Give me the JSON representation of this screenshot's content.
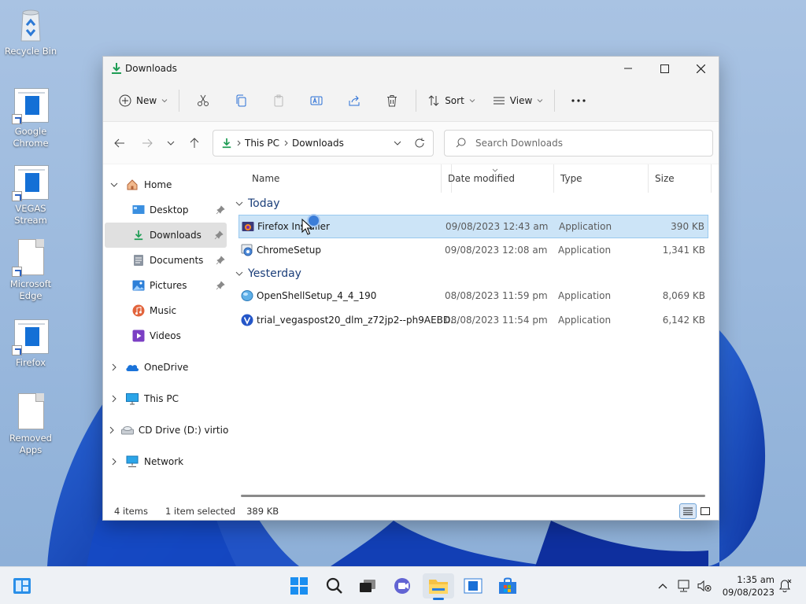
{
  "desktop": {
    "icons": [
      {
        "label": "Recycle Bin",
        "icon": "recycle-bin-icon"
      },
      {
        "label": "Google Chrome",
        "icon": "chrome-shortcut-icon"
      },
      {
        "label": "VEGAS Stream",
        "icon": "vegas-shortcut-icon"
      },
      {
        "label": "Microsoft Edge",
        "icon": "edge-shortcut-icon"
      },
      {
        "label": "Firefox",
        "icon": "firefox-shortcut-icon"
      },
      {
        "label": "Removed Apps",
        "icon": "document-icon"
      }
    ]
  },
  "window": {
    "title": "Downloads",
    "toolbar": {
      "new_label": "New",
      "sort_label": "Sort",
      "view_label": "View"
    },
    "address": {
      "crumbs": [
        "This PC",
        "Downloads"
      ]
    },
    "search": {
      "placeholder": "Search Downloads"
    },
    "nav": {
      "home": "Home",
      "children": [
        "Desktop",
        "Downloads",
        "Documents",
        "Pictures",
        "Music",
        "Videos"
      ],
      "roots": [
        "OneDrive",
        "This PC",
        "CD Drive (D:) virtio-win",
        "Network"
      ]
    },
    "columns": [
      "Name",
      "Date modified",
      "Type",
      "Size"
    ],
    "groups": [
      {
        "label": "Today",
        "files": [
          {
            "name": "Firefox Installer",
            "date": "09/08/2023 12:43 am",
            "type": "Application",
            "size": "390 KB",
            "selected": true
          },
          {
            "name": "ChromeSetup",
            "date": "09/08/2023 12:08 am",
            "type": "Application",
            "size": "1,341 KB",
            "selected": false
          }
        ]
      },
      {
        "label": "Yesterday",
        "files": [
          {
            "name": "OpenShellSetup_4_4_190",
            "date": "08/08/2023 11:59 pm",
            "type": "Application",
            "size": "8,069 KB",
            "selected": false
          },
          {
            "name": "trial_vegaspost20_dlm_z72jp2--ph9AEBD...",
            "date": "08/08/2023 11:54 pm",
            "type": "Application",
            "size": "6,142 KB",
            "selected": false
          }
        ]
      }
    ],
    "status": {
      "count": "4 items",
      "selected": "1 item selected",
      "size": "389 KB"
    }
  },
  "taskbar": {
    "time": "1:35 am",
    "date": "09/08/2023"
  },
  "colors": {
    "accent": "#1a73d9",
    "selection": "#cce4f7",
    "group_text": "#1c3f7a"
  }
}
